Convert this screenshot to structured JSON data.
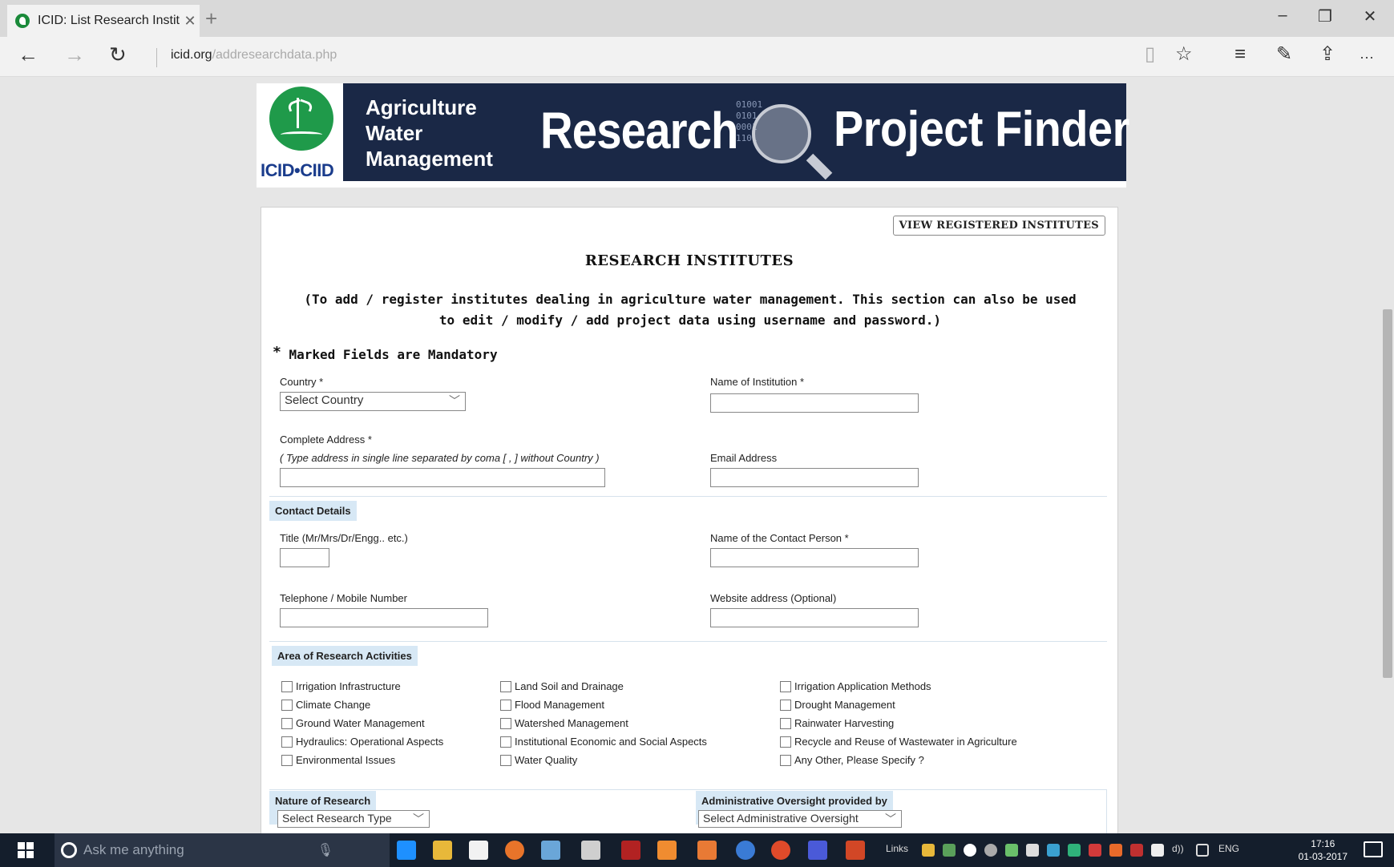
{
  "browser": {
    "tab_title": "ICID: List Research Instit",
    "tab_close": "✕",
    "new_tab": "+",
    "url_domain": "icid.org",
    "url_path": "/addresearchdata.php",
    "win_min": "–",
    "win_max": "❐",
    "win_close": "✕",
    "back": "←",
    "forward": "→",
    "refresh": "↻",
    "reading_view": "▯",
    "favorite": "☆",
    "hub": "≡",
    "note": "✎",
    "share": "⇪",
    "more": "···"
  },
  "banner": {
    "logo_text": "ICID•CIID",
    "awm_line1": "Agriculture",
    "awm_line2": "Water",
    "awm_line3": "Management",
    "research": "Research",
    "binary": "01001\n0101\n0001\n1101",
    "project_finder": "Project Finder"
  },
  "form": {
    "view_button": "VIEW REGISTERED INSTITUTES",
    "title": "RESEARCH INSTITUTES",
    "subtitle": "(To add / register institutes dealing in agriculture water management. This section can also be used to edit / modify / add project data using username and password.)",
    "mandatory_star": "*",
    "mandatory": "Marked Fields are Mandatory",
    "country_label": "Country *",
    "country_value": "Select Country",
    "institution_label": "Name of Institution *",
    "address_label": "Complete Address *",
    "address_hint": "( Type address in single line separated by coma [ , ] without Country )",
    "email_label": "Email Address",
    "contact_section": "Contact Details",
    "title_label": "Title (Mr/Mrs/Dr/Engg.. etc.)",
    "contact_person_label": "Name of the Contact Person *",
    "phone_label": "Telephone / Mobile Number",
    "website_label": "Website address (Optional)",
    "research_section": "Area of Research Activities",
    "research_areas": [
      "Irrigation Infrastructure",
      "Climate Change",
      "Ground Water Management",
      "Hydraulics: Operational Aspects",
      "Environmental Issues",
      "Land Soil and Drainage",
      "Flood Management",
      "Watershed Management",
      "Institutional Economic and Social Aspects",
      "Water Quality",
      "Irrigation Application Methods",
      "Drought Management",
      "Rainwater Harvesting",
      "Recycle and Reuse of Wastewater in Agriculture",
      "Any Other, Please Specify ?"
    ],
    "nature_section": "Nature of Research",
    "nature_value": "Select Research Type",
    "admin_section": "Administrative Oversight provided by",
    "admin_value": "Select Administrative Oversight",
    "chevron": "﹀"
  },
  "taskbar": {
    "search_placeholder": "Ask me anything",
    "mic": "🎙",
    "links": "Links",
    "lang": "ENG",
    "volume": "d))",
    "time": "17:16",
    "date": "01-03-2017"
  }
}
